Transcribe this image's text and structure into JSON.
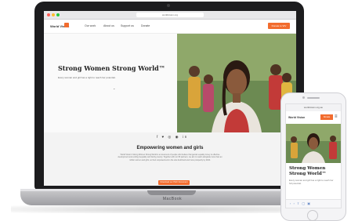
{
  "laptop": {
    "brand_label": "MacBook",
    "browser": {
      "url": "worldvision.org"
    },
    "site": {
      "logo": "World Vision",
      "nav": [
        "Our work",
        "About us",
        "Support us",
        "Donate"
      ],
      "donate_button": "Donate to WV",
      "hero": {
        "title": "Strong Women Strong World™",
        "subtitle": "Every woman and girl has a right to reach her potential.",
        "scroll_arrow": "⌄"
      },
      "social_icons": [
        "facebook-icon",
        "twitter-icon",
        "instagram-icon",
        "pinterest-icon",
        "linkedin-icon"
      ],
      "social_glyphs": "f ♥ ◎ ◉ in",
      "section": {
        "title": "Empowering women and girls",
        "body": "World Vision’s Strong Women Strong World is a movement of people who believe that gender equality is key to effective development and ending inequality and family poverty. Together with our 80 partners, we aim to reach alongside more than an million women and girls, so their empowerment is the sole livelihood and more prosperity by 2024.",
        "button": "Download our Pitch Document"
      }
    }
  },
  "phone": {
    "url": "worldvision.org.au",
    "logo": "World Vision",
    "donate_button": "Donate",
    "menu_glyph": "≡",
    "hero_title": "Strong Women Strong World™",
    "hero_subtitle": "Every woman and girl has a right to reach her full potential.",
    "bottom_bar": "‹   ›   ⇪   ▢   ▣"
  },
  "colors": {
    "accent": "#f26c2e",
    "laptop_bezel": "#1c1c1e",
    "laptop_base": "#b5b5b9"
  }
}
